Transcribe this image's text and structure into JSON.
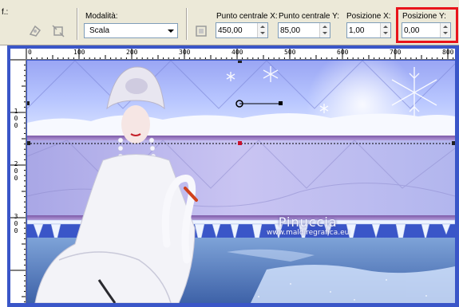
{
  "toolbar": {
    "partial_label": "f.:",
    "mode": {
      "label": "Modalità:",
      "value": "Scala"
    },
    "center_x": {
      "label": "Punto centrale X:",
      "value": "450,00"
    },
    "center_y": {
      "label": "Punto centrale Y:",
      "value": "85,00"
    },
    "pos_x": {
      "label": "Posizione X:",
      "value": "1,00"
    },
    "pos_y": {
      "label": "Posizione Y:",
      "value": "0,00"
    }
  },
  "ruler": {
    "h_labels": [
      "0",
      "100",
      "200",
      "300",
      "400",
      "500",
      "600",
      "700",
      "800"
    ],
    "v_labels": [
      [
        "1",
        "0",
        "0"
      ],
      [
        "2",
        "0",
        "0"
      ],
      [
        "3",
        "0",
        "0"
      ]
    ]
  },
  "image": {
    "watermark_title": "Pinuccia",
    "watermark_url": "www.maldiregrafica.eu"
  },
  "colors": {
    "highlight": "#e8141b",
    "frame": "#3a56c8"
  },
  "icons": [
    "transform-icon-1",
    "transform-icon-2",
    "reset-icon"
  ]
}
